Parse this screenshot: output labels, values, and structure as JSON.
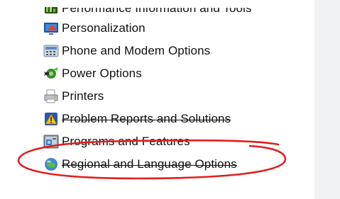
{
  "items": [
    {
      "label": "Performance Information and Tools",
      "icon": "performance-icon",
      "strike": false
    },
    {
      "label": "Personalization",
      "icon": "personalization-icon",
      "strike": false
    },
    {
      "label": "Phone and Modem Options",
      "icon": "phone-modem-icon",
      "strike": false
    },
    {
      "label": "Power Options",
      "icon": "power-options-icon",
      "strike": false
    },
    {
      "label": "Printers",
      "icon": "printers-icon",
      "strike": false
    },
    {
      "label": "Problem Reports and Solutions",
      "icon": "problem-reports-icon",
      "strike": true
    },
    {
      "label": "Programs and Features",
      "icon": "programs-features-icon",
      "strike": false
    },
    {
      "label": "Regional and Language Options",
      "icon": "regional-language-icon",
      "strike": true
    }
  ],
  "annotation": {
    "color": "#e02020",
    "target": "Programs and Features"
  }
}
